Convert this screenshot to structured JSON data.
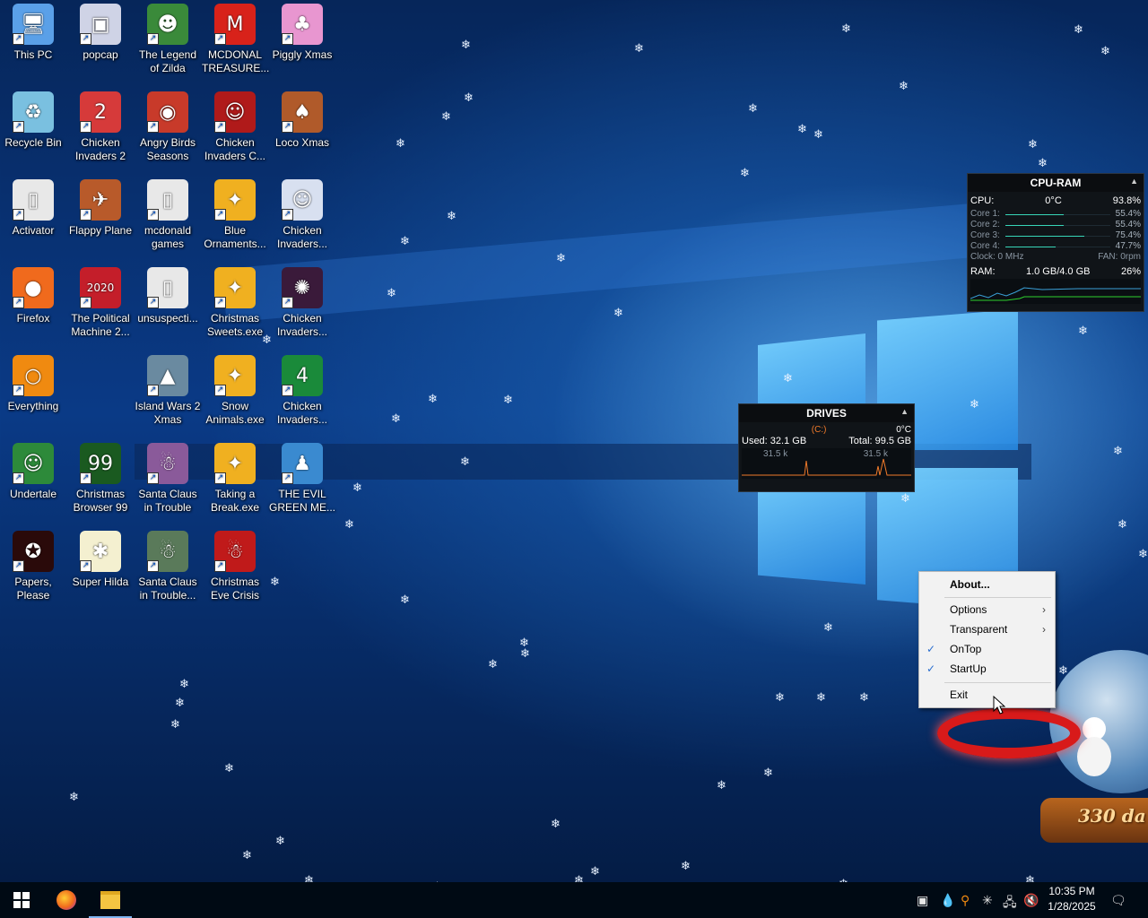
{
  "desktop": {
    "icons": [
      {
        "label": "This PC",
        "color": "#5aa0e8",
        "glyph": "🖥"
      },
      {
        "label": "Recycle Bin",
        "color": "#7ac0e0",
        "glyph": "♻"
      },
      {
        "label": "Activator",
        "color": "#e8e8e8",
        "glyph": "▯"
      },
      {
        "label": "Firefox",
        "color": "#f06a1d",
        "glyph": "●"
      },
      {
        "label": "Everything",
        "color": "#f08a10",
        "glyph": "○"
      },
      {
        "label": "Undertale",
        "color": "#2d8a3a",
        "glyph": "☺"
      },
      {
        "label": "Papers, Please",
        "color": "#2a0a0a",
        "glyph": "✪"
      },
      {
        "label": "popcap",
        "color": "#cfd3e6",
        "glyph": "▣"
      },
      {
        "label": "Chicken Invaders 2",
        "color": "#d63a3a",
        "glyph": "2"
      },
      {
        "label": "Flappy Plane",
        "color": "#b85a2a",
        "glyph": "✈"
      },
      {
        "label": "The Political Machine 2...",
        "color": "#c41e2a",
        "glyph": "2020"
      },
      {
        "label": "Christmas Browser 99",
        "color": "#1a5a20",
        "glyph": "99"
      },
      {
        "label": "Super Hilda",
        "color": "#f4f0d0",
        "glyph": "✱"
      },
      {
        "label": "The Legend of Zilda",
        "color": "#3a8a3a",
        "glyph": "☻"
      },
      {
        "label": "Angry Birds Seasons",
        "color": "#c83a2a",
        "glyph": "◉"
      },
      {
        "label": "mcdonald games",
        "color": "#e8e8e8",
        "glyph": "▯"
      },
      {
        "label": "unsuspecti...",
        "color": "#e8e8e8",
        "glyph": "▯"
      },
      {
        "label": "Island Wars 2 Xmas",
        "color": "#6a8aa0",
        "glyph": "▲"
      },
      {
        "label": "Santa Claus in Trouble",
        "color": "#8a5a9a",
        "glyph": "☃"
      },
      {
        "label": "Santa Claus in Trouble...",
        "color": "#5a7a5a",
        "glyph": "☃"
      },
      {
        "label": "MCDONAL TREASURE...",
        "color": "#d8221a",
        "glyph": "M"
      },
      {
        "label": "Chicken Invaders C...",
        "color": "#b01a1a",
        "glyph": "☺"
      },
      {
        "label": "Blue Ornaments...",
        "color": "#f0b020",
        "glyph": "✦"
      },
      {
        "label": "Christmas Sweets.exe",
        "color": "#f0b020",
        "glyph": "✦"
      },
      {
        "label": "Snow Animals.exe",
        "color": "#f0b020",
        "glyph": "✦"
      },
      {
        "label": "Taking a Break.exe",
        "color": "#f0b020",
        "glyph": "✦"
      },
      {
        "label": "Christmas Eve Crisis",
        "color": "#c01a1a",
        "glyph": "☃"
      },
      {
        "label": "Piggly Xmas",
        "color": "#e896d0",
        "glyph": "♣"
      },
      {
        "label": "Loco Xmas",
        "color": "#b05a2a",
        "glyph": "♠"
      },
      {
        "label": "Chicken Invaders...",
        "color": "#d8e0f0",
        "glyph": "☺"
      },
      {
        "label": "Chicken Invaders...",
        "color": "#3a1a3a",
        "glyph": "✺"
      },
      {
        "label": "Chicken Invaders...",
        "color": "#1a8a3a",
        "glyph": "4"
      },
      {
        "label": "THE EVIL GREEN ME...",
        "color": "#3a8ad0",
        "glyph": "♟"
      }
    ]
  },
  "cpu_ram": {
    "title": "CPU-RAM",
    "cpu_label": "CPU:",
    "cpu_temp": "0°C",
    "cpu_pct": "93.8%",
    "cores": [
      {
        "label": "Core 1:",
        "value": "55.4%",
        "level": 0.554
      },
      {
        "label": "Core 2:",
        "value": "55.4%",
        "level": 0.554
      },
      {
        "label": "Core 3:",
        "value": "75.4%",
        "level": 0.754
      },
      {
        "label": "Core 4:",
        "value": "47.7%",
        "level": 0.477
      }
    ],
    "clock": "Clock: 0 MHz",
    "fan": "FAN: 0rpm",
    "ram_label": "RAM:",
    "ram_value": "1.0 GB/4.0 GB",
    "ram_pct": "26%"
  },
  "drives": {
    "title": "DRIVES",
    "drive": "(C:)",
    "temp": "0°C",
    "used": "Used: 32.1 GB",
    "total": "Total: 99.5 GB",
    "read": "31.5 k",
    "write": "31.5 k"
  },
  "context_menu": {
    "items": [
      {
        "label": "About...",
        "bold": true,
        "checked": false,
        "submenu": false
      },
      {
        "label": "Options",
        "bold": false,
        "checked": false,
        "submenu": true
      },
      {
        "label": "Transparent",
        "bold": false,
        "checked": false,
        "submenu": true
      },
      {
        "label": "OnTop",
        "bold": false,
        "checked": true,
        "submenu": false
      },
      {
        "label": "StartUp",
        "bold": false,
        "checked": true,
        "submenu": false
      },
      {
        "label": "Exit",
        "bold": false,
        "checked": false,
        "submenu": false
      }
    ]
  },
  "snowglobe": {
    "counter": "330 da"
  },
  "taskbar": {
    "start_icon": "windows-logo-icon",
    "pinned": [
      "firefox-icon",
      "file-explorer-icon"
    ],
    "tray_icons": [
      "app-tray-icon",
      "droplet-icon",
      "search-everything-icon",
      "snowflake-icon",
      "network-icon",
      "volume-muted-icon"
    ],
    "time": "10:35 PM",
    "date": "1/28/2025",
    "notification_icon": "action-center-icon"
  }
}
